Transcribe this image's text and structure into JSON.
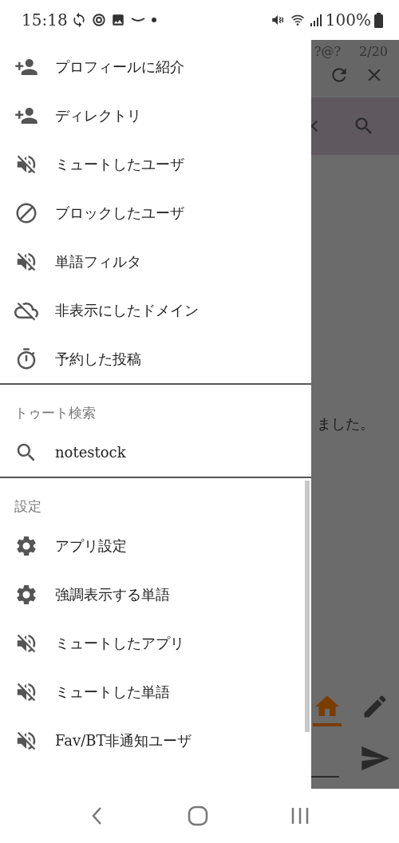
{
  "status_bar": {
    "time": "15:18",
    "battery": "100%"
  },
  "drawer": {
    "sections": [
      {
        "items": [
          {
            "kind": "add-person",
            "label": "プロフィールに紹介"
          },
          {
            "kind": "add-person",
            "label": "ディレクトリ"
          },
          {
            "kind": "mute",
            "label": "ミュートしたユーザ"
          },
          {
            "kind": "block",
            "label": "ブロックしたユーザ"
          },
          {
            "kind": "mute",
            "label": "単語フィルタ"
          },
          {
            "kind": "cloud-off",
            "label": "非表示にしたドメイン"
          },
          {
            "kind": "timer",
            "label": "予約した投稿"
          }
        ]
      },
      {
        "header": "トゥート検索",
        "items": [
          {
            "kind": "search",
            "label": "notestock"
          }
        ]
      },
      {
        "header": "設定",
        "items": [
          {
            "kind": "gear",
            "label": "アプリ設定"
          },
          {
            "kind": "gear",
            "label": "強調表示する単語"
          },
          {
            "kind": "mute",
            "label": "ミュートしたアプリ"
          },
          {
            "kind": "mute",
            "label": "ミュートした単語"
          },
          {
            "kind": "mute",
            "label": "Fav/BT非通知ユーザ"
          }
        ]
      }
    ]
  },
  "background": {
    "account": "?@?",
    "counter": "2/20",
    "post_text": "ました。",
    "home_tab": {
      "selected": true
    }
  }
}
